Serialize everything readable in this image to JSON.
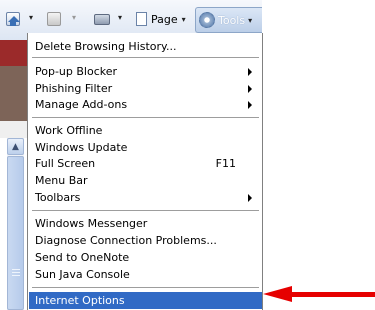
{
  "toolbar": {
    "page_label": "Page",
    "tools_label": "Tools",
    "dropdown_glyph": "▾",
    "icons": [
      "home-icon",
      "rss-icon",
      "print-icon",
      "page-icon",
      "gear-icon"
    ]
  },
  "tools_menu": {
    "groups": [
      {
        "items": [
          {
            "label": "Delete Browsing History..."
          }
        ]
      },
      {
        "items": [
          {
            "label": "Pop-up Blocker",
            "submenu": true
          },
          {
            "label": "Phishing Filter",
            "submenu": true
          },
          {
            "label": "Manage Add-ons",
            "submenu": true
          }
        ]
      },
      {
        "items": [
          {
            "label": "Work Offline"
          },
          {
            "label": "Windows Update"
          },
          {
            "label": "Full Screen",
            "shortcut": "F11"
          },
          {
            "label": "Menu Bar"
          },
          {
            "label": "Toolbars",
            "submenu": true
          }
        ]
      },
      {
        "items": [
          {
            "label": "Windows Messenger"
          },
          {
            "label": "Diagnose Connection Problems..."
          },
          {
            "label": "Send to OneNote"
          },
          {
            "label": "Sun Java Console"
          }
        ]
      },
      {
        "items": [
          {
            "label": "Internet Options",
            "highlighted": true
          }
        ]
      }
    ]
  },
  "colors": {
    "highlight": "#316ac5",
    "annotation_arrow": "#e60000"
  }
}
